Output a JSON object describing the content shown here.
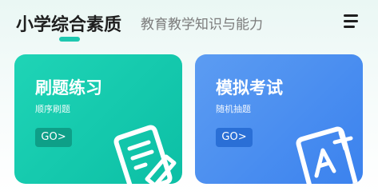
{
  "header": {
    "active_tab": "小学综合素质",
    "inactive_tab": "教育教学知识与能力",
    "menu_icon": "menu-icon"
  },
  "cards": [
    {
      "title": "刷题练习",
      "subtitle": "顺序刷题",
      "go_label": "GO>",
      "icon": "note-pencil-icon",
      "color": "#12cbb0"
    },
    {
      "title": "模拟考试",
      "subtitle": "随机抽题",
      "go_label": "GO>",
      "icon": "grade-a-plus-icon",
      "color": "#4a8ef0"
    }
  ],
  "colors": {
    "accent": "#1ec8b0",
    "practice_card": "#12cbb0",
    "exam_card": "#4a8ef0"
  }
}
